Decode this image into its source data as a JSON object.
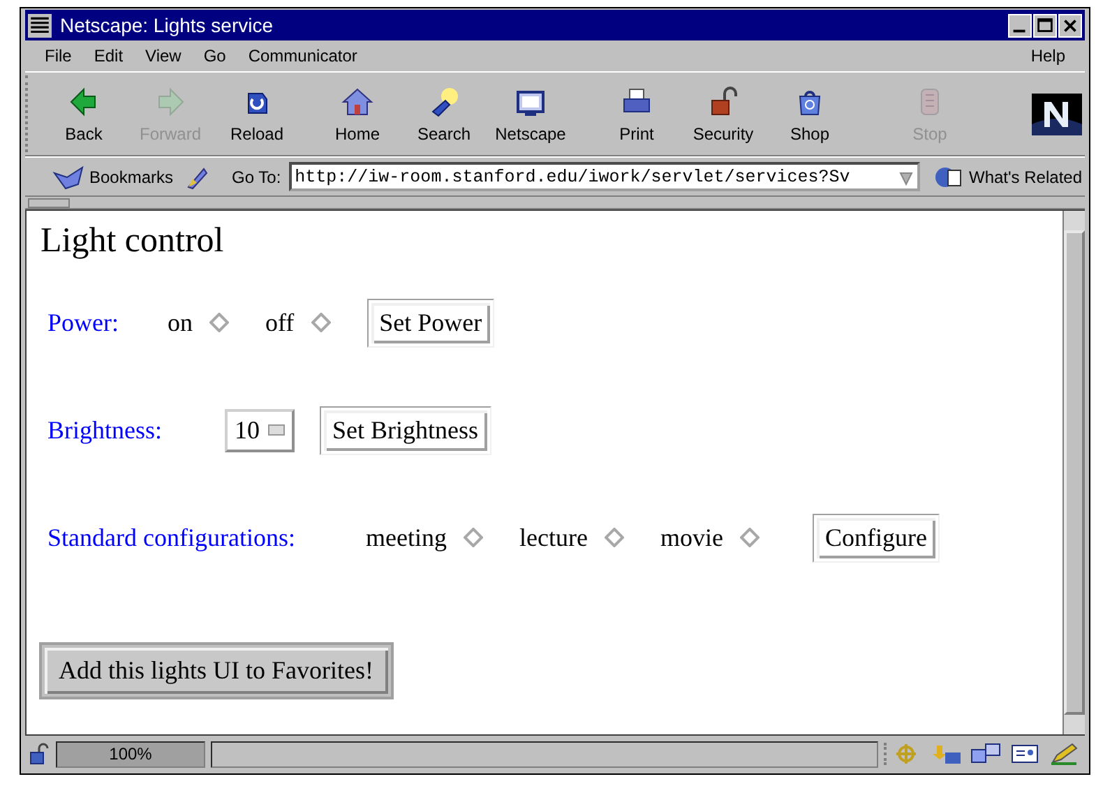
{
  "window": {
    "title": "Netscape: Lights service"
  },
  "menu": [
    {
      "label": "File"
    },
    {
      "label": "Edit"
    },
    {
      "label": "View"
    },
    {
      "label": "Go"
    },
    {
      "label": "Communicator"
    }
  ],
  "help_menu": {
    "label": "Help"
  },
  "toolbar": [
    {
      "label": "Back",
      "kind": "back",
      "disabled": false
    },
    {
      "label": "Forward",
      "kind": "forward",
      "disabled": true
    },
    {
      "label": "Reload",
      "kind": "reload",
      "disabled": false
    },
    {
      "label": "Home",
      "kind": "home",
      "disabled": false
    },
    {
      "label": "Search",
      "kind": "search",
      "disabled": false
    },
    {
      "label": "Netscape",
      "kind": "netscape",
      "disabled": false
    },
    {
      "label": "Print",
      "kind": "print",
      "disabled": false
    },
    {
      "label": "Security",
      "kind": "security",
      "disabled": false
    },
    {
      "label": "Shop",
      "kind": "shop",
      "disabled": false
    },
    {
      "label": "Stop",
      "kind": "stop",
      "disabled": true
    }
  ],
  "location_bar": {
    "bookmarks": "Bookmarks",
    "goto_label": "Go To:",
    "url": "http://iw-room.stanford.edu/iwork/servlet/services?Sv",
    "related": "What's Related"
  },
  "page": {
    "heading": "Light control",
    "power": {
      "label": "Power:",
      "options": [
        {
          "label": "on",
          "selected": false
        },
        {
          "label": "off",
          "selected": false
        }
      ],
      "button": "Set Power"
    },
    "brightness": {
      "label": "Brightness:",
      "value": "10",
      "button": "Set Brightness"
    },
    "configurations": {
      "label": "Standard configurations:",
      "options": [
        {
          "label": "meeting",
          "selected": false
        },
        {
          "label": "lecture",
          "selected": false
        },
        {
          "label": "movie",
          "selected": false
        }
      ],
      "button": "Configure"
    },
    "favorites_button": "Add this lights UI to Favorites!"
  },
  "status_bar": {
    "zoom": "100%"
  }
}
